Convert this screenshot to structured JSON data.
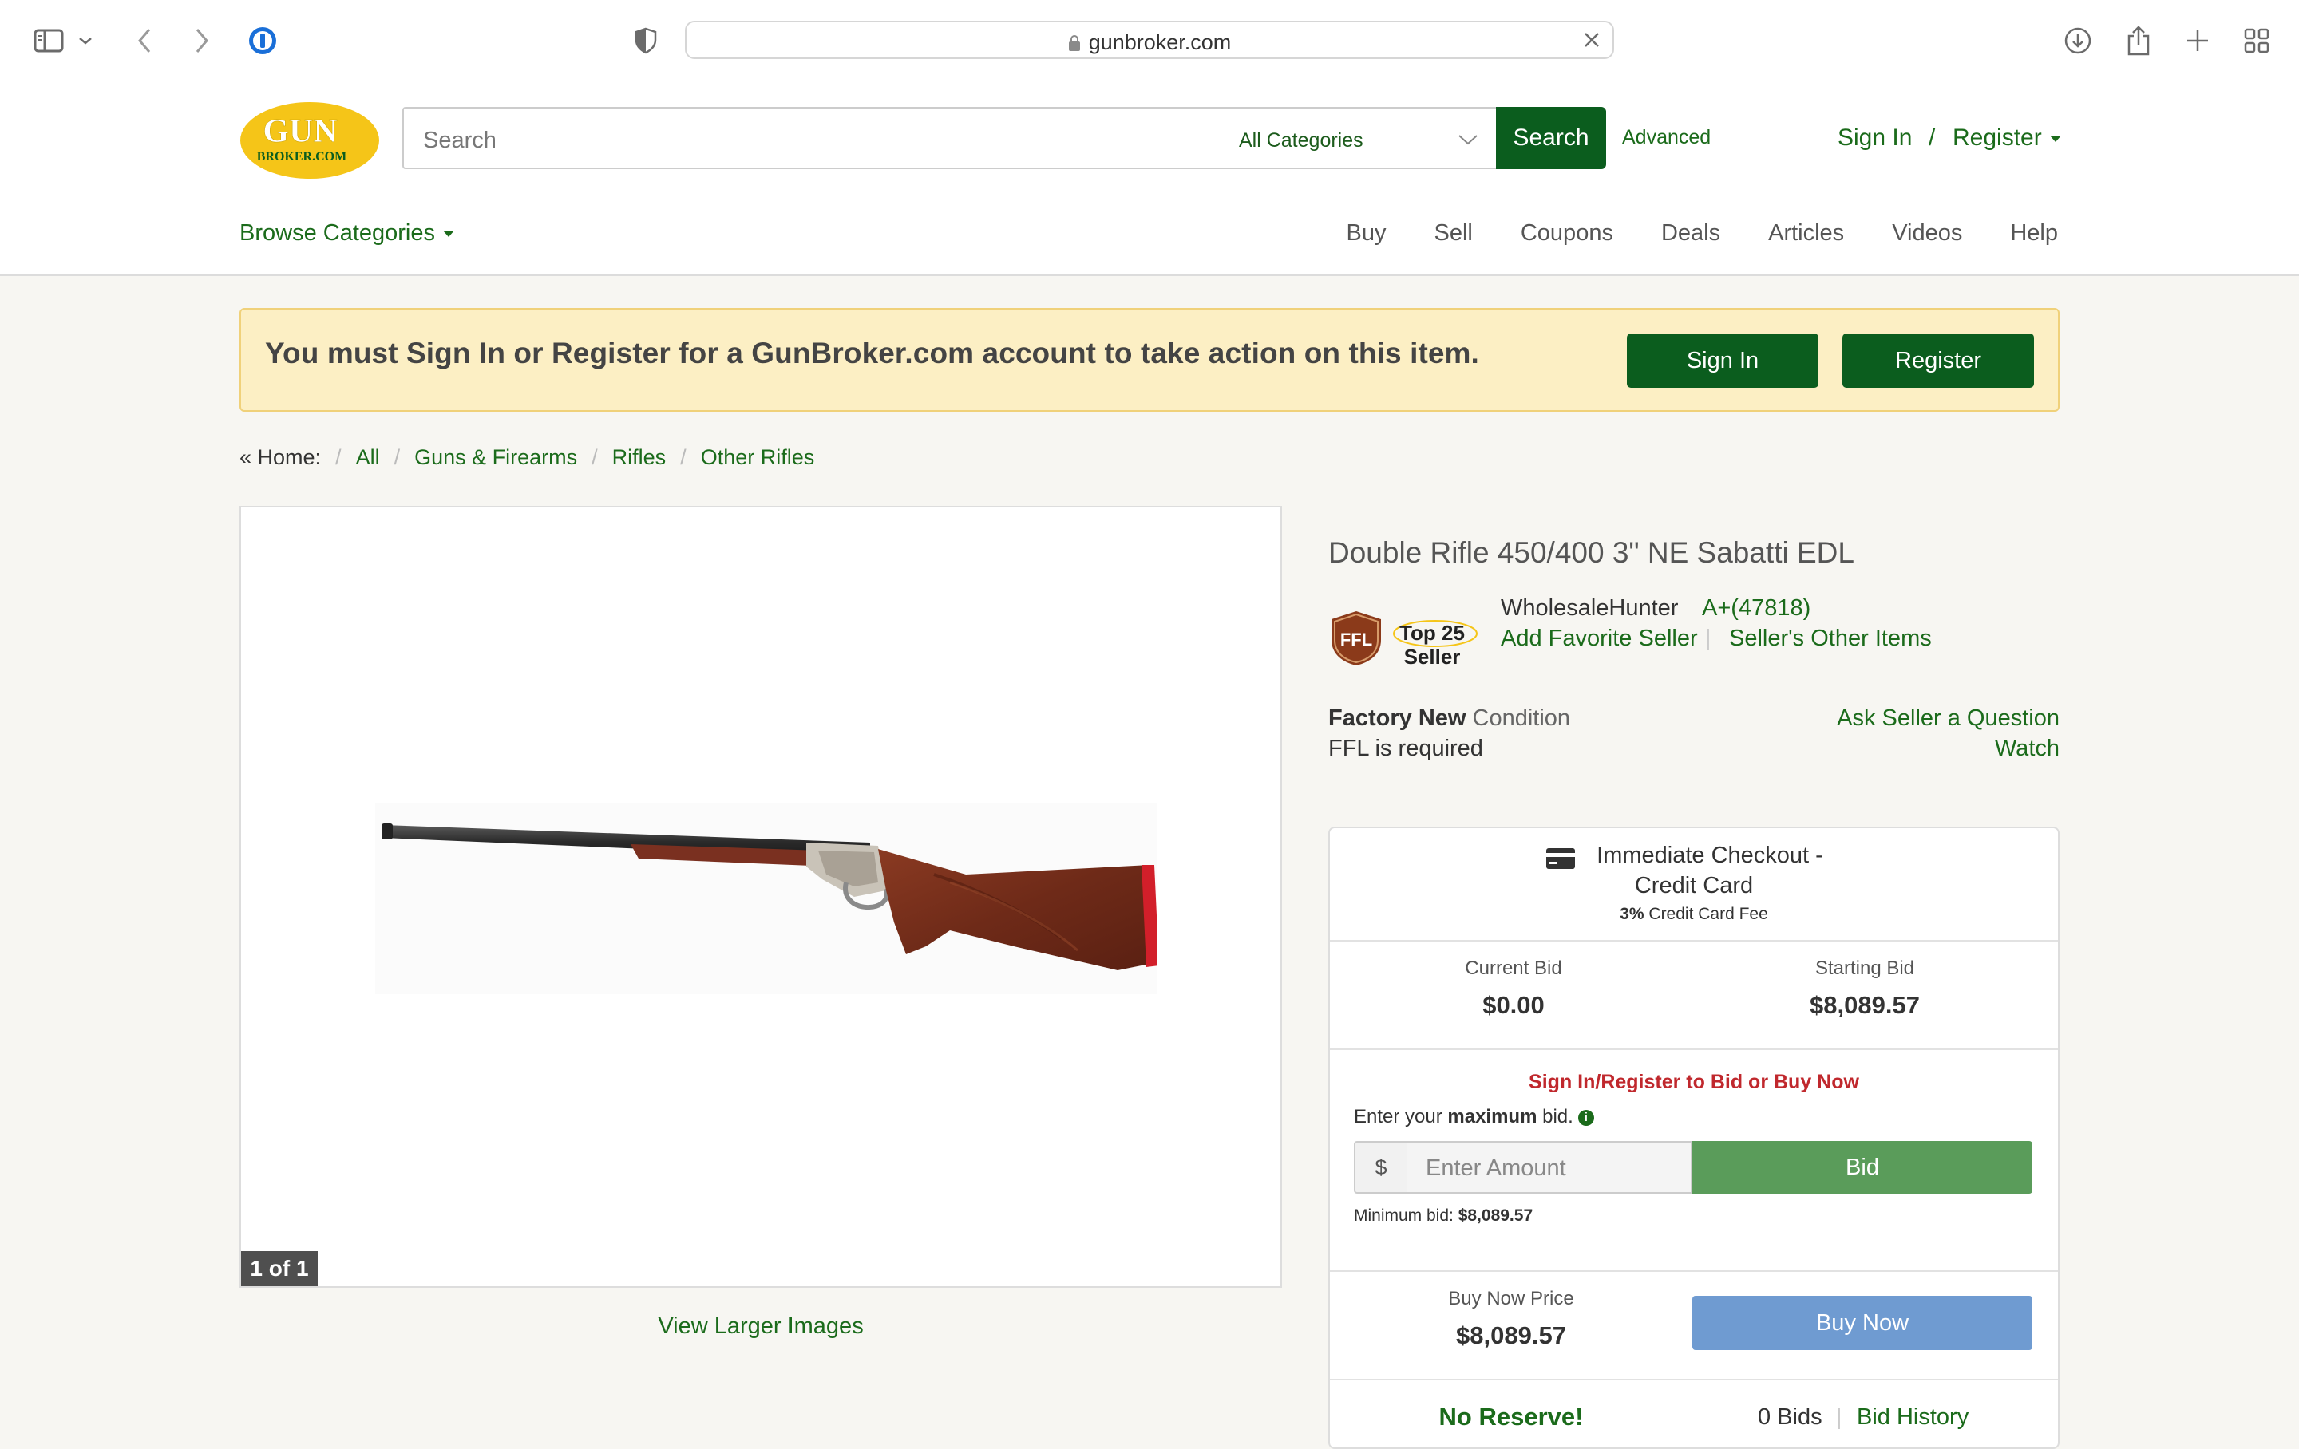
{
  "browser": {
    "url": "gunbroker.com"
  },
  "header": {
    "logo_text_top": "GUN",
    "logo_text_bottom": "BROKER.COM",
    "search_placeholder": "Search",
    "category_select": "All Categories",
    "search_button": "Search",
    "advanced_link": "Advanced",
    "sign_in": "Sign In",
    "slash": "/",
    "register": "Register",
    "browse_categories": "Browse Categories",
    "nav": [
      "Buy",
      "Sell",
      "Coupons",
      "Deals",
      "Articles",
      "Videos",
      "Help"
    ]
  },
  "notice": {
    "text": "You must Sign In or Register for a GunBroker.com account to take action on this item.",
    "sign_in_button": "Sign In",
    "register_button": "Register"
  },
  "breadcrumb": {
    "home": "« Home:",
    "items": [
      "All",
      "Guns & Firearms",
      "Rifles",
      "Other Rifles"
    ],
    "separator": "/"
  },
  "gallery": {
    "counter": "1 of 1",
    "view_larger": "View Larger Images"
  },
  "item": {
    "title": "Double Rifle 450/400 3\" NE Sabatti EDL",
    "badge_ffl": "FFL",
    "badge_top": "Top 25",
    "badge_seller": "Seller",
    "seller_name": "WholesaleHunter",
    "seller_rating": "A+(47818)",
    "add_favorite": "Add Favorite Seller",
    "seller_separator": "|",
    "other_items": "Seller's Other Items",
    "condition_bold": "Factory New",
    "condition_suffix": " Condition",
    "ffl_required": "FFL is required",
    "ask_question": "Ask Seller a Question",
    "watch": "Watch"
  },
  "bidbox": {
    "checkout_line1": "Immediate Checkout -",
    "checkout_line2": "Credit Card",
    "fee_bold": "3%",
    "fee_text": " Credit Card Fee",
    "current_bid_label": "Current Bid",
    "current_bid_value": "$0.00",
    "starting_bid_label": "Starting Bid",
    "starting_bid_value": "$8,089.57",
    "must_signin": "Sign In/Register to Bid or Buy Now",
    "enter_prefix": "Enter your ",
    "enter_bold": "maximum",
    "enter_suffix": " bid.",
    "info_icon": "i",
    "currency": "$",
    "amount_placeholder": "Enter Amount",
    "bid_button": "Bid",
    "min_bid_label": "Minimum bid: ",
    "min_bid_value": "$8,089.57",
    "buy_now_label": "Buy Now Price",
    "buy_now_value": "$8,089.57",
    "buy_now_button": "Buy Now",
    "no_reserve": "No Reserve!",
    "bids_count": "0 Bids",
    "bids_separator": "|",
    "bid_history": "Bid History"
  },
  "colors": {
    "brand_green": "#0b5d1e",
    "link_green": "#1b6b1b",
    "logo_yellow": "#f5c518",
    "notice_bg": "#fcefc4",
    "error_red": "#c0282d",
    "buy_now_blue": "#6f9bd1"
  },
  "icons": [
    "sidebar-icon",
    "chevron-down-icon",
    "back-icon",
    "forward-icon",
    "password-manager-icon",
    "shield-icon",
    "lock-icon",
    "close-icon",
    "download-icon",
    "share-icon",
    "plus-icon",
    "tab-grid-icon",
    "credit-card-icon",
    "info-icon"
  ]
}
